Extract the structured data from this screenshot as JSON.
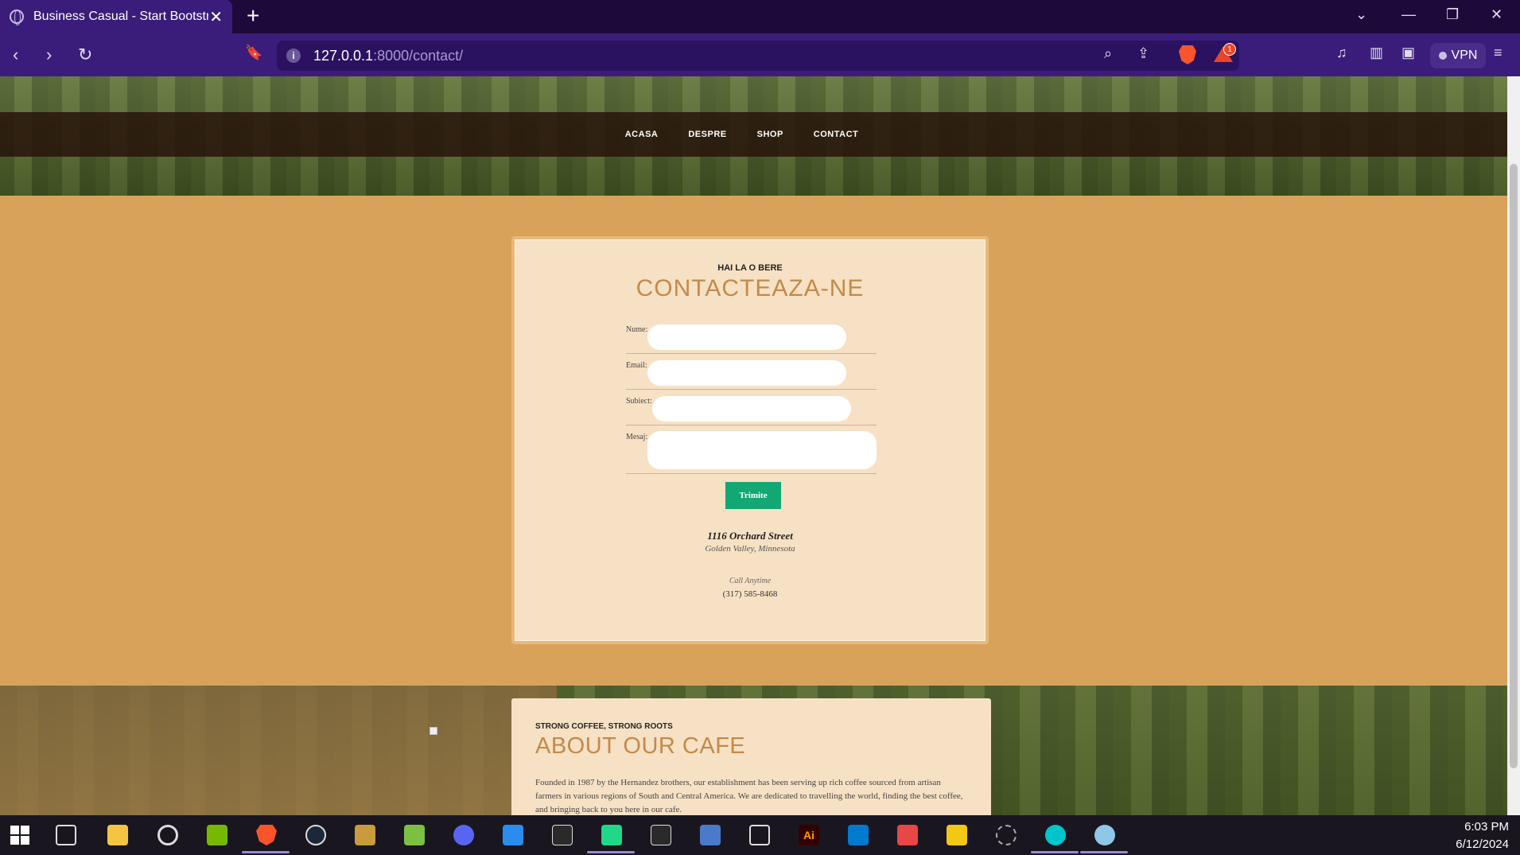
{
  "browser": {
    "tab_title": "Business Casual - Start Bootstrap",
    "url_host": "127.0.0.1",
    "url_path": ":8000/contact/",
    "vpn_label": "VPN",
    "rewards_count": "1"
  },
  "nav": {
    "items": [
      "ACASA",
      "DESPRE",
      "SHOP",
      "CONTACT"
    ]
  },
  "contact": {
    "subheading": "HAI LA O BERE",
    "heading": "CONTACTEAZA-NE",
    "fields": {
      "name_label": "Nume:",
      "email_label": "Email:",
      "subject_label": "Subiect:",
      "message_label": "Mesaj:"
    },
    "submit_label": "Trimite",
    "address_line1": "1116 Orchard Street",
    "address_line2": "Golden Valley, Minnesota",
    "call_label": "Call Anytime",
    "phone": "(317) 585-8468"
  },
  "about": {
    "subheading": "STRONG COFFEE, STRONG ROOTS",
    "heading": "ABOUT OUR CAFE",
    "text": "Founded in 1987 by the Hernandez brothers, our establishment has been serving up rich coffee sourced from artisan farmers in various regions of South and Central America. We are dedicated to travelling the world, finding the best coffee, and bringing back to you here in our cafe."
  },
  "taskbar": {
    "time": "6:03 PM",
    "date": "6/12/2024",
    "apps": [
      "start",
      "task-view",
      "file-explorer",
      "ubisoft",
      "nvidia",
      "brave",
      "steam",
      "league",
      "notepad",
      "discord",
      "bing",
      "epic-games",
      "pycharm",
      "epic-games-2",
      "installer",
      "virtualbox",
      "illustrator",
      "vscode",
      "bookmark",
      "power-bi",
      "spider",
      "canva",
      "paint"
    ]
  },
  "colors": {
    "accent": "#12a874",
    "heading": "#c4894a",
    "card": "#f7e1c4",
    "section": "#d9a25a",
    "browser": "#3a1d7a"
  }
}
